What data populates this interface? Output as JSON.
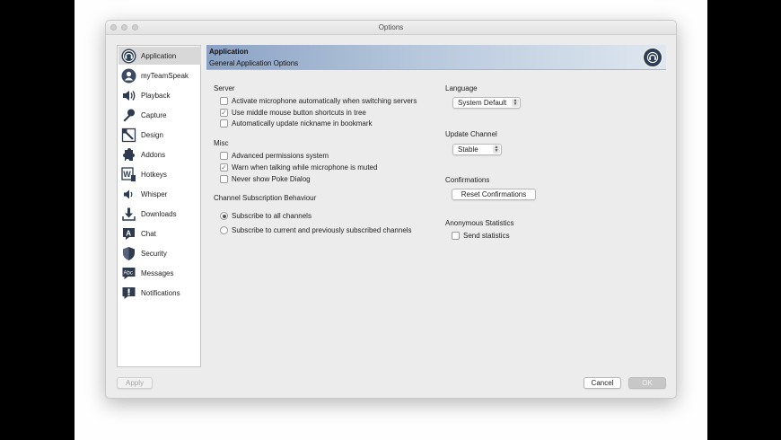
{
  "window": {
    "title": "Options"
  },
  "sidebar": {
    "items": [
      {
        "label": "Application",
        "icon": "application-icon",
        "selected": true
      },
      {
        "label": "myTeamSpeak",
        "icon": "myteamspeak-icon"
      },
      {
        "label": "Playback",
        "icon": "speaker-icon"
      },
      {
        "label": "Capture",
        "icon": "microphone-icon"
      },
      {
        "label": "Design",
        "icon": "design-icon"
      },
      {
        "label": "Addons",
        "icon": "puzzle-icon"
      },
      {
        "label": "Hotkeys",
        "icon": "keyboard-icon"
      },
      {
        "label": "Whisper",
        "icon": "whisper-icon"
      },
      {
        "label": "Downloads",
        "icon": "download-icon"
      },
      {
        "label": "Chat",
        "icon": "chat-icon"
      },
      {
        "label": "Security",
        "icon": "shield-icon"
      },
      {
        "label": "Messages",
        "icon": "messages-icon"
      },
      {
        "label": "Notifications",
        "icon": "notifications-icon"
      }
    ]
  },
  "header": {
    "title": "Application",
    "subtitle": "General Application Options",
    "logo": "teamspeak-logo-icon"
  },
  "server": {
    "label": "Server",
    "options": [
      {
        "label": "Activate microphone automatically when switching servers",
        "checked": false
      },
      {
        "label": "Use middle mouse button shortcuts in tree",
        "checked": true
      },
      {
        "label": "Automatically update nickname in bookmark",
        "checked": false
      }
    ]
  },
  "misc": {
    "label": "Misc",
    "options": [
      {
        "label": "Advanced permissions system",
        "checked": false
      },
      {
        "label": "Warn when talking while microphone is muted",
        "checked": true
      },
      {
        "label": "Never show Poke Dialog",
        "checked": false
      }
    ]
  },
  "subscription": {
    "label": "Channel Subscription Behaviour",
    "options": [
      {
        "label": "Subscribe to all channels",
        "selected": true
      },
      {
        "label": "Subscribe to current and previously subscribed channels",
        "selected": false
      }
    ]
  },
  "language": {
    "label": "Language",
    "value": "System Default"
  },
  "update_channel": {
    "label": "Update Channel",
    "value": "Stable"
  },
  "confirmations": {
    "label": "Confirmations",
    "button": "Reset Confirmations"
  },
  "statistics": {
    "label": "Anonymous Statistics",
    "option": {
      "label": "Send statistics",
      "checked": false
    }
  },
  "footer": {
    "apply": "Apply",
    "cancel": "Cancel",
    "ok": "OK"
  },
  "colors": {
    "header_start": "#8aa2c4",
    "header_end": "#dfe7f0",
    "selection": "#d8d8d8"
  }
}
